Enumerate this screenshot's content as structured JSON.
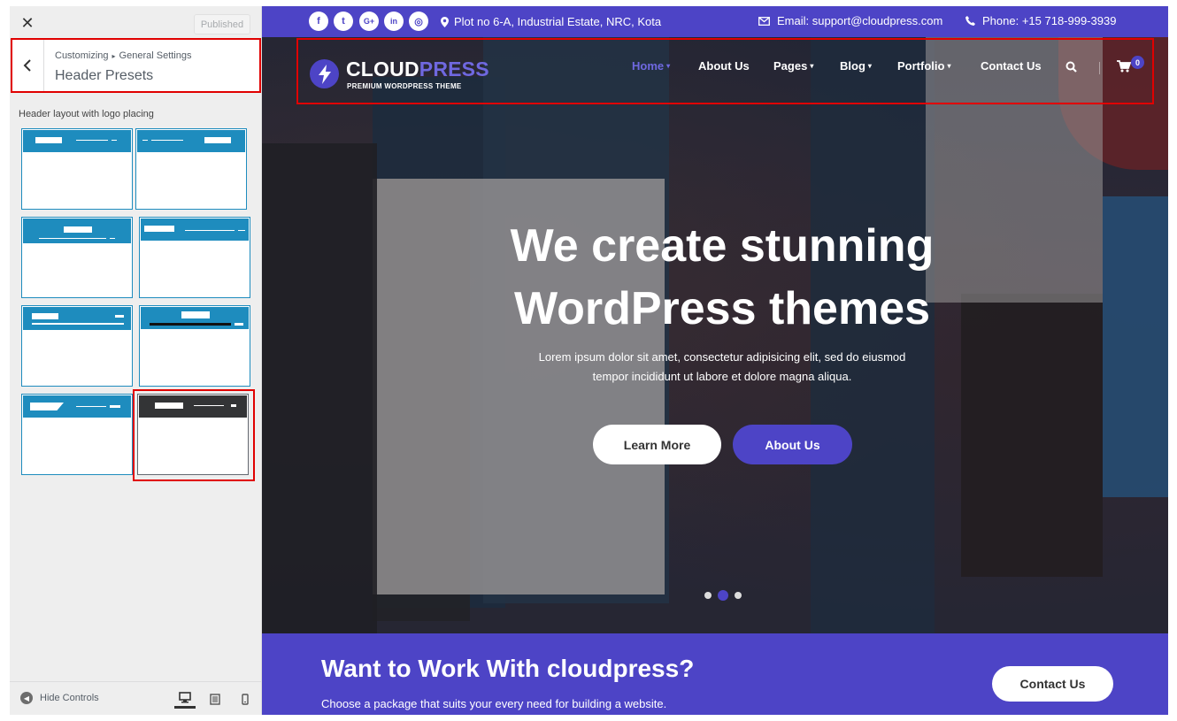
{
  "customizer": {
    "close_label": "✕",
    "published_label": "Published",
    "breadcrumb": {
      "parent": "Customizing",
      "separator": "▸",
      "current": "General Settings"
    },
    "section_title": "Header Presets",
    "presets_label": "Header layout with logo placing",
    "selected_preset": 8,
    "footer": {
      "hide_controls_label": "Hide Controls",
      "devices": [
        "desktop-icon",
        "tablet-icon",
        "mobile-icon"
      ],
      "active_device": "desktop"
    }
  },
  "site": {
    "topbar": {
      "social_icons": [
        "facebook-icon",
        "twitter-icon",
        "google-plus-icon",
        "linkedin-icon",
        "instagram-icon"
      ],
      "social_glyphs": [
        "f",
        "t",
        "G+",
        "in",
        "◎"
      ],
      "address": "Plot no 6-A, Industrial Estate, NRC, Kota",
      "email": "Email: support@cloudpress.com",
      "phone": "Phone: +15 718-999-3939"
    },
    "logo": {
      "cloud": "CLOUD",
      "press": "PRESS",
      "tagline": "PREMIUM WORDPRESS THEME"
    },
    "nav": {
      "items": [
        {
          "label": "Home",
          "caret": "▾"
        },
        {
          "label": "About Us",
          "caret": ""
        },
        {
          "label": "Pages",
          "caret": "▾"
        },
        {
          "label": "Blog",
          "caret": "▾"
        },
        {
          "label": "Portfolio",
          "caret": "▾"
        },
        {
          "label": "Contact Us",
          "caret": ""
        }
      ],
      "cart_count": "0"
    },
    "hero": {
      "title_line1": "We create stunning",
      "title_line2": "WordPress themes",
      "text_line1": "Lorem ipsum dolor sit amet, consectetur adipisicing elit, sed do eiusmod",
      "text_line2": "tempor incididunt ut labore et dolore magna aliqua.",
      "primary_button": "Learn More",
      "secondary_button": "About Us",
      "slides": 3,
      "active_slide": 2
    },
    "cta": {
      "title": "Want to Work With cloudpress?",
      "text": "Choose a package that suits your every need for building a website.",
      "button": "Contact Us"
    }
  },
  "colors": {
    "accent": "#4d44c6",
    "preset_blue": "#1e8cbe",
    "preset_dark": "#333436",
    "highlight_red": "#e00000",
    "panel_bg": "#eeeeee"
  }
}
